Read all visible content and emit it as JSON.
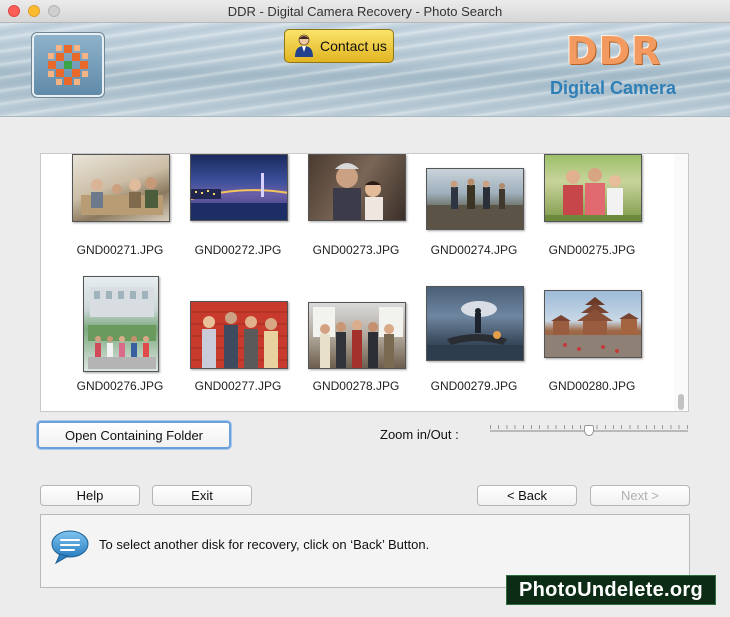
{
  "window": {
    "title": "DDR - Digital Camera Recovery - Photo Search"
  },
  "header": {
    "contact_label": "Contact us",
    "brand": "DDR",
    "brand_sub": "Digital Camera",
    "colors": {
      "brand": "#f29a5f",
      "sub": "#2f7fb7"
    }
  },
  "gallery": {
    "items": [
      {
        "name": "GND00271.JPG",
        "icon": "photo-family-couch"
      },
      {
        "name": "GND00272.JPG",
        "icon": "photo-bridge-night"
      },
      {
        "name": "GND00273.JPG",
        "icon": "photo-grandmother-child"
      },
      {
        "name": "GND00274.JPG",
        "icon": "photo-people-viewpoint"
      },
      {
        "name": "GND00275.JPG",
        "icon": "photo-family-park"
      },
      {
        "name": "GND00276.JPG",
        "icon": "photo-group-building"
      },
      {
        "name": "GND00277.JPG",
        "icon": "photo-friends-wall"
      },
      {
        "name": "GND00278.JPG",
        "icon": "photo-group-city"
      },
      {
        "name": "GND00279.JPG",
        "icon": "photo-fisherman-lake"
      },
      {
        "name": "GND00280.JPG",
        "icon": "photo-temple-square"
      }
    ]
  },
  "controls": {
    "open_folder_label": "Open Containing Folder",
    "zoom_label": "Zoom in/Out :",
    "zoom_level": 0.5
  },
  "footer": {
    "help_label": "Help",
    "exit_label": "Exit",
    "back_label": "< Back",
    "next_label": "Next >"
  },
  "message": {
    "text": "To select another disk for recovery, click on ‘Back’ Button."
  },
  "watermark": {
    "text": "PhotoUndelete.org"
  }
}
